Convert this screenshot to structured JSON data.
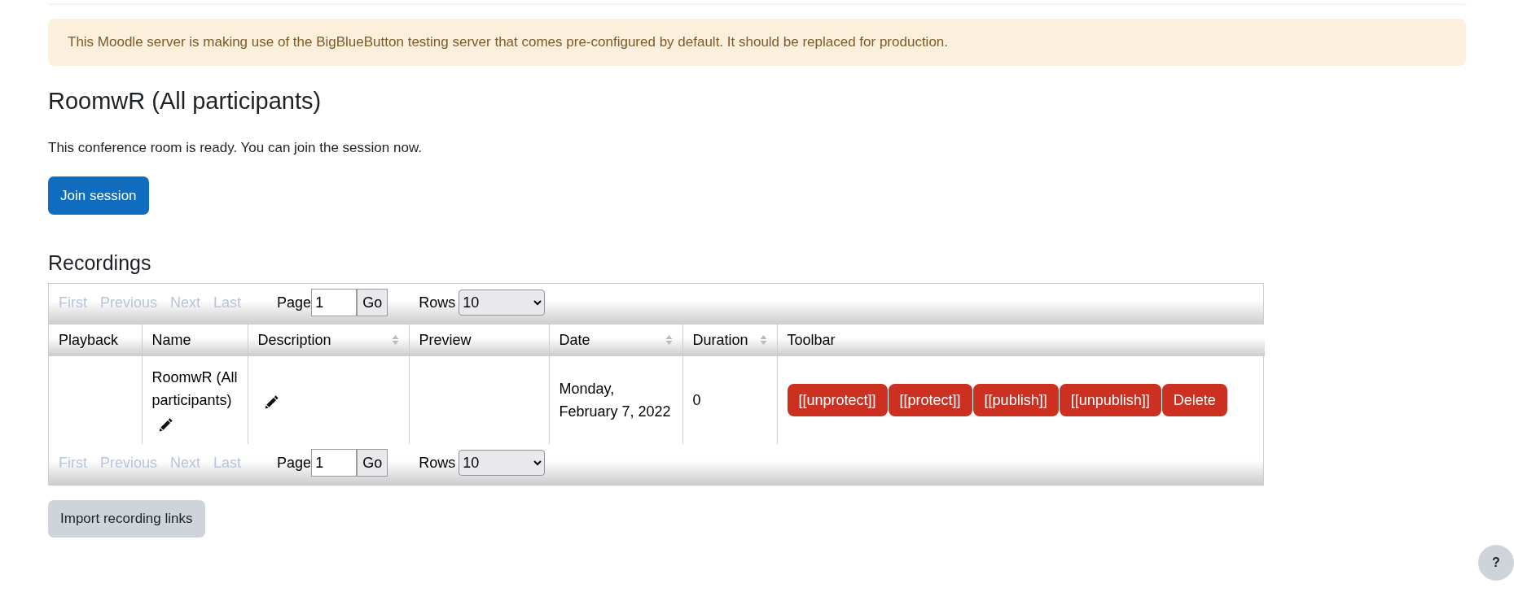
{
  "alert": {
    "text": "This Moodle server is making use of the BigBlueButton testing server that comes pre-configured by default. It should be replaced for production."
  },
  "title": "RoomwR (All participants)",
  "status_text": "This conference room is ready. You can join the session now.",
  "join_button": "Join session",
  "recordings": {
    "heading": "Recordings",
    "pagers": [
      {
        "links": [
          {
            "label": "First",
            "disabled": true
          },
          {
            "label": "Previous",
            "disabled": true
          },
          {
            "label": "Next",
            "disabled": true
          },
          {
            "label": "Last",
            "disabled": true
          }
        ],
        "page_label": "Page",
        "page_value": "1",
        "go": "Go",
        "rows_label": "Rows",
        "rows_value": "10"
      },
      {
        "links": [
          {
            "label": "First",
            "disabled": true
          },
          {
            "label": "Previous",
            "disabled": true
          },
          {
            "label": "Next",
            "disabled": true
          },
          {
            "label": "Last",
            "disabled": true
          }
        ],
        "page_label": "Page",
        "page_value": "1",
        "go": "Go",
        "rows_label": "Rows",
        "rows_value": "10"
      }
    ],
    "columns": [
      {
        "label": "Playback",
        "sortable": false
      },
      {
        "label": "Name",
        "sortable": false
      },
      {
        "label": "Description",
        "sortable": true
      },
      {
        "label": "Preview",
        "sortable": false
      },
      {
        "label": "Date",
        "sortable": true
      },
      {
        "label": "Duration",
        "sortable": true
      },
      {
        "label": "Toolbar",
        "sortable": false
      }
    ],
    "rows": [
      {
        "name": "RoomwR (All participants)",
        "name_editable": true,
        "description_editable": true,
        "date": "Monday, February 7, 2022",
        "duration": "0",
        "toolbar": [
          "[[unprotect]]",
          "[[protect]]",
          "[[publish]]",
          "[[unpublish]]",
          "Delete"
        ]
      }
    ]
  },
  "import_button": "Import recording links",
  "help_button": "?"
}
